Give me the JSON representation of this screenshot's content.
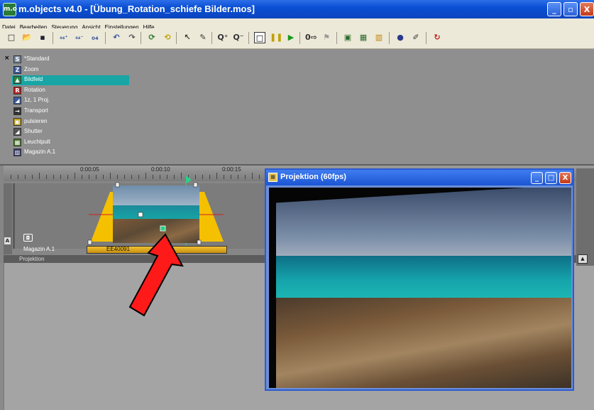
{
  "window": {
    "app_icon": "m.o",
    "title": "m.objects v4.0 - [Übung_Rotation_schiefe Bilder.mos]",
    "min": "_",
    "max": "▫",
    "close": "X"
  },
  "menu": [
    "Datei",
    "Bearbeiten",
    "Steuerung",
    "Ansicht",
    "Einstellungen",
    "Hilfe"
  ],
  "toolbar": [
    {
      "name": "new-file-icon",
      "glyph": "□"
    },
    {
      "name": "open-folder-icon",
      "glyph": "📂"
    },
    {
      "name": "save-icon",
      "glyph": "▪"
    },
    {
      "name": "object-add-icon",
      "glyph": "₀₄⁺"
    },
    {
      "name": "object-remove-icon",
      "glyph": "₀₄⁻"
    },
    {
      "name": "object-icon",
      "glyph": "₀₄"
    },
    {
      "name": "undo-icon",
      "glyph": "↶"
    },
    {
      "name": "redo-icon",
      "glyph": "↷"
    },
    {
      "name": "cycle-icon",
      "glyph": "⟳"
    },
    {
      "name": "cycle-alt-icon",
      "glyph": "⟲"
    },
    {
      "name": "pointer-icon",
      "glyph": "↖"
    },
    {
      "name": "draw-icon",
      "glyph": "✎"
    },
    {
      "name": "zoom-in-icon",
      "glyph": "Q⁺"
    },
    {
      "name": "zoom-out-icon",
      "glyph": "Q⁻"
    },
    {
      "name": "stop-icon",
      "glyph": "□"
    },
    {
      "name": "pause-icon",
      "glyph": "❚❚"
    },
    {
      "name": "play-icon",
      "glyph": "▶"
    },
    {
      "name": "counter-icon",
      "glyph": "0⇨"
    },
    {
      "name": "flag-icon",
      "glyph": "⚑"
    },
    {
      "name": "light-table-icon",
      "glyph": "▣"
    },
    {
      "name": "screen-icon",
      "glyph": "▦"
    },
    {
      "name": "magazine-icon",
      "glyph": "▥"
    },
    {
      "name": "tools-icon",
      "glyph": "●"
    },
    {
      "name": "wand-icon",
      "glyph": "✐"
    },
    {
      "name": "loop-icon",
      "glyph": "↻"
    }
  ],
  "objects": {
    "close_glyph": "×",
    "items": [
      {
        "label": "*Standard",
        "icon": "S",
        "color": "#7a8aa0"
      },
      {
        "label": "Zoom",
        "icon": "Z",
        "color": "#3a5aa0"
      },
      {
        "label": "Bildfeld",
        "icon": "▲",
        "color": "#2a8a4a"
      },
      {
        "label": "Rotation",
        "icon": "R",
        "color": "#c02020"
      },
      {
        "label": "1z, 1 Proj.",
        "icon": "◢",
        "color": "#3a5aa0"
      },
      {
        "label": "Transport",
        "icon": "→",
        "color": "#333333"
      },
      {
        "label": "pulsieren",
        "icon": "▣",
        "color": "#c0a020"
      },
      {
        "label": "Shutter",
        "icon": "◢",
        "color": "#555555"
      },
      {
        "label": "Leuchtpult",
        "icon": "▦",
        "color": "#4a7a2a"
      },
      {
        "label": "Magazin A.1",
        "icon": "▥",
        "color": "#3a3a6a"
      }
    ],
    "selected_index": 2
  },
  "timeline": {
    "ruler_labels": [
      "0:00:05",
      "0:00:10",
      "0:00:15"
    ],
    "track_label": "Magazin A.1",
    "clip_label": "EE40091",
    "camera_glyph": "◘",
    "side_letter": "A",
    "projection_label": "Projektion"
  },
  "projection_window": {
    "icon": "▦",
    "title": "Projektion (60fps)",
    "min": "_",
    "max": "□",
    "close": "X"
  },
  "right_strip": {
    "up_glyph": "▲"
  },
  "colors": {
    "xp_blue": "#0a4fd4",
    "selection": "#17a5a5",
    "annotation_arrow": "#ff1a1a",
    "keyframe_yellow": "#f5c000"
  }
}
